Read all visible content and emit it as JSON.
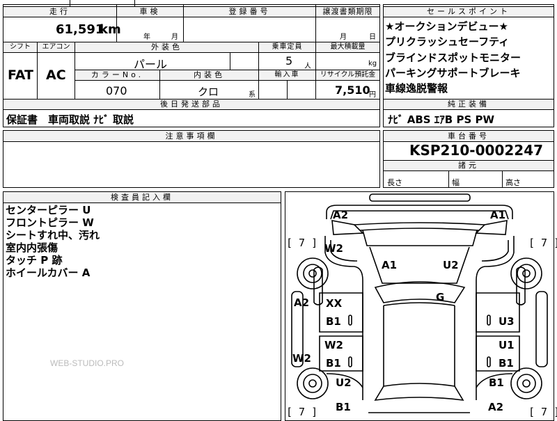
{
  "main": {
    "mileage": {
      "header": "走行",
      "value": "61,591",
      "unit": "km"
    },
    "inspection": {
      "header": "車検",
      "year_unit": "年",
      "month_unit": "月"
    },
    "registration": {
      "header": "登録番号"
    },
    "transfer": {
      "header": "譲渡書類期限",
      "month_unit": "月",
      "day_unit": "日"
    },
    "shift": {
      "header": "シフト",
      "value": "FAT"
    },
    "aircon": {
      "header": "エアコン",
      "value": "AC"
    },
    "exterior": {
      "header": "外装色",
      "value": "パール"
    },
    "capacity": {
      "header": "乗車定員",
      "value": "5",
      "unit": "人"
    },
    "max_load": {
      "header": "最大積載量",
      "unit": "kg"
    },
    "color_no": {
      "header": "カラーNo.",
      "value": "070"
    },
    "interior": {
      "header": "内装色",
      "value": "クロ",
      "suffix": "系"
    },
    "import": {
      "header": "輸入車"
    },
    "recycle": {
      "header": "リサイクル預託金",
      "value": "7,510",
      "unit": "円"
    },
    "later_parts": {
      "header": "後日発送部品",
      "value": "保証書　車両取説 ﾅﾋﾞ 取説"
    },
    "notes": {
      "header": "注意事項欄"
    },
    "inspector": {
      "header": "検査員記入欄",
      "lines": [
        "センターピラー U",
        "フロントピラー W",
        "シートすれ中、汚れ",
        "室内内張傷",
        "タッチ P 跡",
        "ホイールカバー A"
      ]
    }
  },
  "sales_points": {
    "header": "セールスポイント",
    "items": [
      "★オークションデビュー★",
      "プリクラッシュセーフティ",
      "ブラインドスポットモニター",
      "パーキングサポートブレーキ",
      "車線逸脱警報"
    ]
  },
  "equipment": {
    "header": "純正装備",
    "value": "ﾅﾋﾞ ABS ｴｱB PS PW"
  },
  "chassis": {
    "header": "車台番号",
    "value": "KSP210-0002247"
  },
  "dimensions": {
    "header": "諸元",
    "length": "長さ",
    "width": "幅",
    "height": "高さ"
  },
  "diagram": {
    "labels": {
      "front_left_top": "A2",
      "front_right_top": "A1",
      "left_front_fender": "W2",
      "hood_left": "A1",
      "hood_right": "U2",
      "roof": "G",
      "left_front_door_1": "XX",
      "left_front_door_2": "B1",
      "right_front_door": "U3",
      "left_rear_door_1": "W2",
      "left_rear_door_2": "B1",
      "right_rear_door_1": "U1",
      "right_rear_door_2": "B1",
      "left_sill_front": "A2",
      "left_sill_rear": "W2",
      "left_rear_fender": "U2",
      "right_rear_fender": "B1",
      "rear_left": "B1",
      "rear_right": "A2"
    },
    "tire_front_left": "[ 7 ]",
    "tire_front_right": "[ 7 ]",
    "tire_rear_left": "[ 7 ]",
    "tire_rear_right": "[ 7 ]"
  },
  "watermark": "WEB-STUDIO.PRO"
}
